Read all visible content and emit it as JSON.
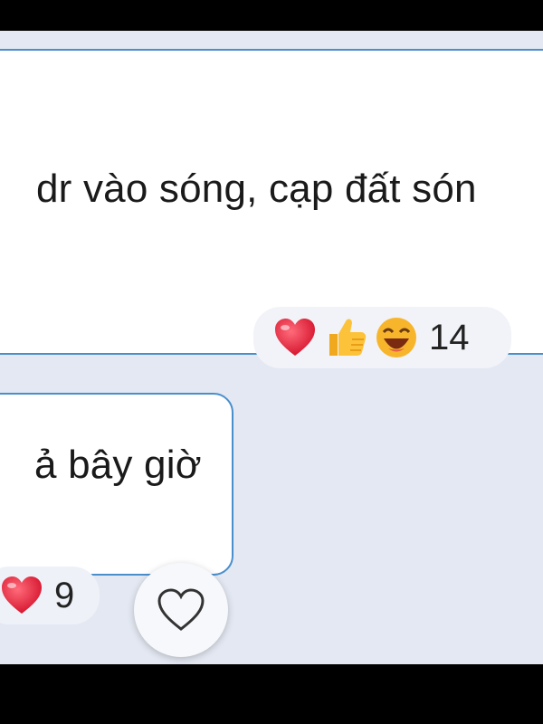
{
  "messages": [
    {
      "text": "dr vào sóng, cạp đất són",
      "reactions": [
        "heart",
        "thumbs-up",
        "laughing"
      ],
      "reaction_count": "14"
    },
    {
      "text": "ả bây giờ",
      "reactions": [
        "heart"
      ],
      "reaction_count": "9"
    }
  ],
  "icons": {
    "like": "heart-outline-icon"
  },
  "colors": {
    "chat_background": "#e3e8f2",
    "bubble_border": "#4a8fcc",
    "bubble_fill": "#ffffff"
  }
}
